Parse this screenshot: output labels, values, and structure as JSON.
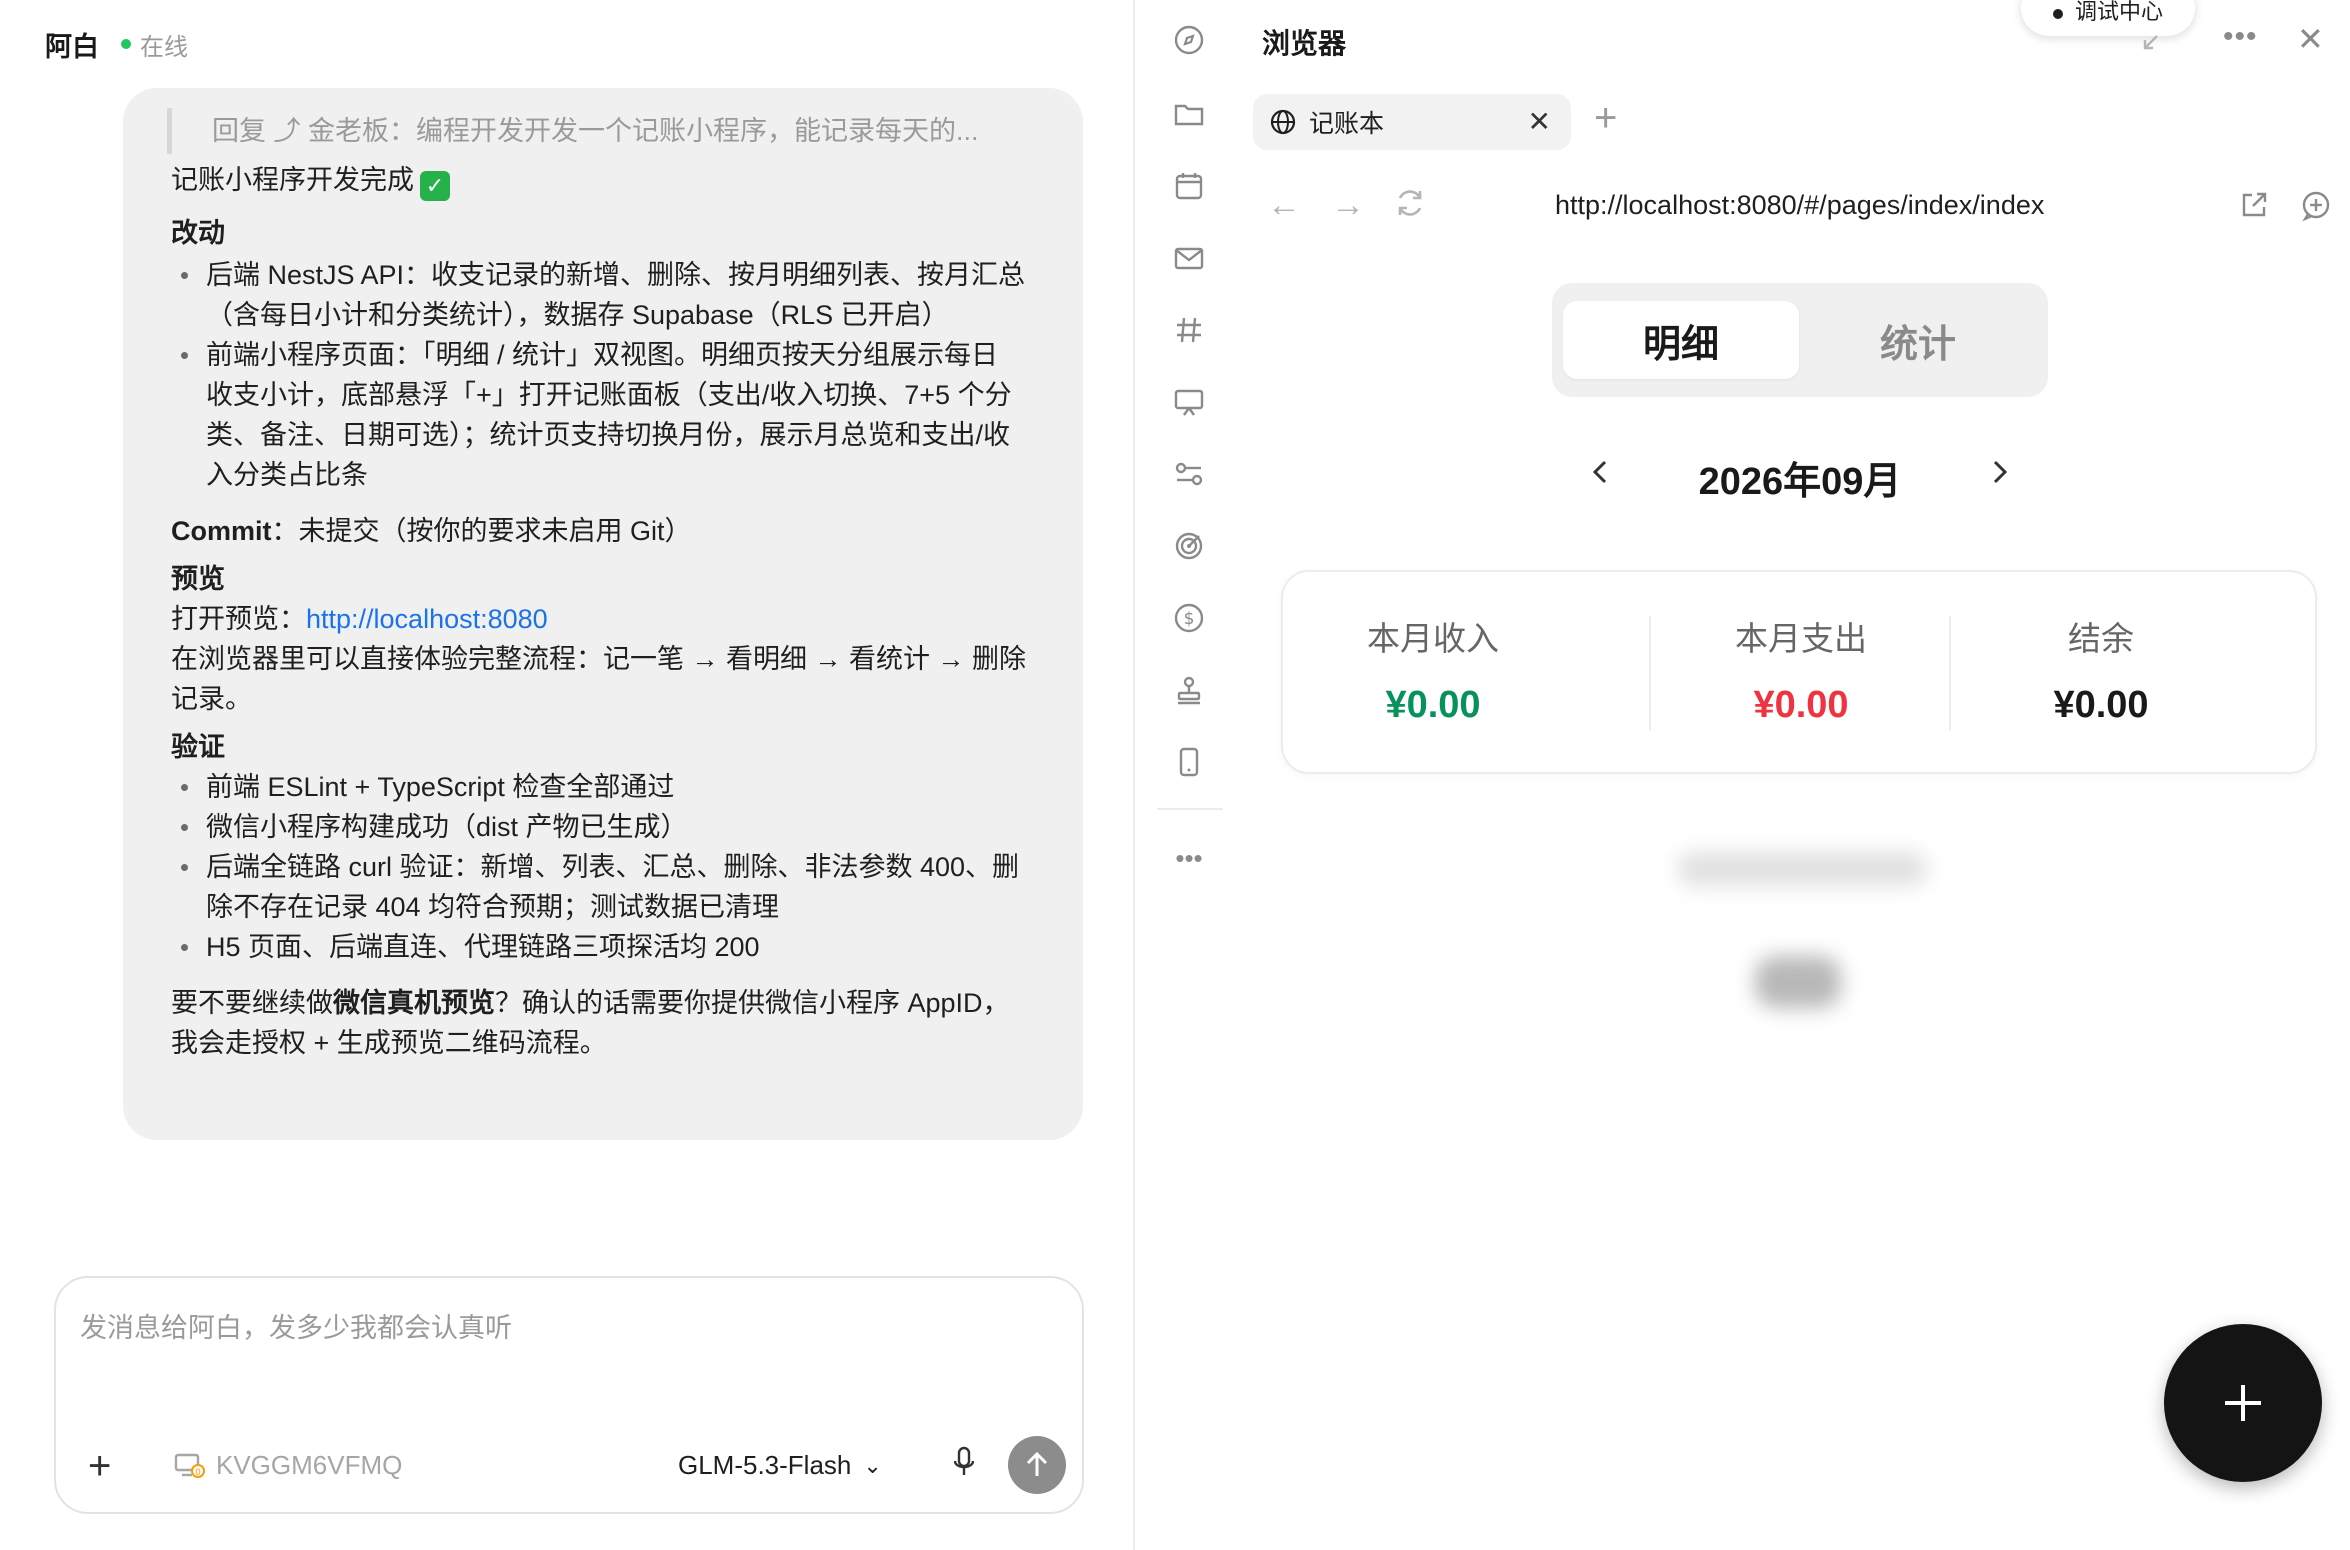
{
  "chat": {
    "contact_name": "阿白",
    "status": "在线",
    "message": {
      "reply_quote": "回复 ⤴ 金老板：编程开发开发一个记账小程序，能记录每天的...",
      "title": "记账小程序开发完成",
      "title_badge": "✓",
      "changes_heading": "改动",
      "changes": [
        "后端 NestJS API：收支记录的新增、删除、按月明细列表、按月汇总",
        "（含每日小计和分类统计），数据存 Supabase（RLS 已开启）",
        "前端小程序页面：「明细 / 统计」双视图。明细页按天分组展示每日",
        "收支小计，底部悬浮「+」打开记账面板（支出/收入切换、7+5 个分",
        "类、备注、日期可选）；统计页支持切换月份，展示月总览和支出/收",
        "入分类占比条"
      ],
      "commit_label": "Commit",
      "commit_text": "：未提交（按你的要求未启用 Git）",
      "preview_heading": "预览",
      "preview_open_label": "打开预览：",
      "preview_link": "http://localhost:8080",
      "preview_desc_1": "在浏览器里可以直接体验完整流程：记一笔 → 看明细 → 看统计 → 删除",
      "preview_desc_2": "记录。",
      "verify_heading": "验证",
      "verify_items": [
        "前端 ESLint + TypeScript 检查全部通过",
        "微信小程序构建成功（dist 产物已生成）",
        "后端全链路 curl 验证：新增、列表、汇总、删除、非法参数 400、删",
        "除不存在记录 404 均符合预期；测试数据已清理",
        "H5 页面、后端直连、代理链路三项探活均 200"
      ],
      "closing_1a": "要不要继续做",
      "closing_1b": "微信真机预览",
      "closing_1c": "？确认的话需要你提供微信小程序 AppID，",
      "closing_2": "我会走授权 + 生成预览二维码流程。"
    }
  },
  "composer": {
    "placeholder": "发消息给阿白，发多少我都会认真听",
    "device_id": "KVGGM6VFMQ",
    "model": "GLM-5.3-Flash"
  },
  "browser": {
    "title": "浏览器",
    "debug_label": "调试中心",
    "tab_label": "记账本",
    "url": "http://localhost:8080/#/pages/index/index",
    "app": {
      "seg_active": "明细",
      "seg_inactive": "统计",
      "month": "2026年09月",
      "income_label": "本月收入",
      "income_value": "¥0.00",
      "expense_label": "本月支出",
      "expense_value": "¥0.00",
      "balance_label": "结余",
      "balance_value": "¥0.00",
      "fab_symbol": "+"
    }
  },
  "colors": {
    "income": "#07925c",
    "expense": "#ef3340",
    "link": "#1a73e8",
    "online_dot": "#22c55e"
  }
}
